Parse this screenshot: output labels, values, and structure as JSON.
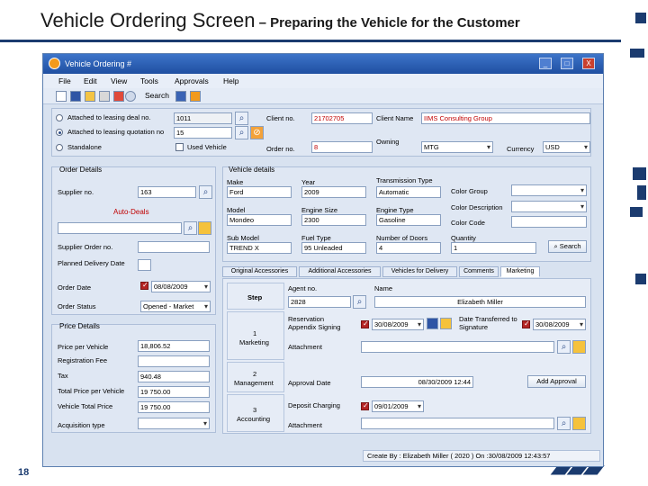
{
  "slide": {
    "title_main": "Vehicle Ordering Screen",
    "title_sub": " – Preparing the Vehicle for the Customer",
    "page_number": "18",
    "brand_color": "#1b3b6f"
  },
  "window": {
    "title": "Vehicle Ordering #",
    "title_color": "#1f4fa1",
    "minimize_label": "_",
    "maximize_label": "□",
    "close_label": "X"
  },
  "menu": {
    "items": [
      "File",
      "Edit",
      "View",
      "Tools",
      "Approvals",
      "Help"
    ]
  },
  "toolbar": {
    "search_label": "Search"
  },
  "order_source": {
    "option1": "Attached to leasing deal no.",
    "option2": "Attached to leasing quotation no",
    "option3": "Standalone",
    "deal_no": "1011",
    "quotation_no": "15",
    "used_vehicle_label": "Used Vehicle",
    "client_no_label": "Client no.",
    "client_no": "21702705",
    "client_name_label": "Client Name",
    "client_name": "IIMS Consulting Group",
    "order_no_label": "Order no.",
    "order_no": "8",
    "owning_label": "Owning",
    "owning_value": "MTG",
    "currency_label": "Currency",
    "currency_value": "USD"
  },
  "order_details": {
    "title": "Order Details",
    "supplier_no_label": "Supplier no.",
    "supplier_no": "163",
    "supplier_name": "Auto-Deals",
    "supplier_order_label": "Supplier Order no.",
    "planned_delivery_label": "Planned Delivery Date",
    "order_date_label": "Order Date",
    "order_date": "08/08/2009",
    "order_status_label": "Order Status",
    "order_status": "Opened - Market"
  },
  "price_details": {
    "title": "Price Details",
    "price_per_vehicle_label": "Price per Vehicle",
    "price_per_vehicle": "18,806.52",
    "registration_fee_label": "Registration Fee",
    "tax_label": "Tax",
    "tax": "940.48",
    "total_price_label": "Total Price per Vehicle",
    "total_price": "19 750.00",
    "vehicle_total_label": "Vehicle Total Price",
    "vehicle_total": "19 750.00",
    "acquisition_label": "Acquisition type"
  },
  "vehicle_details": {
    "title": "Vehicle details",
    "make_label": "Make",
    "make": "Ford",
    "year_label": "Year",
    "year": "2009",
    "transmission_label": "Transmission Type",
    "transmission": "Automatic",
    "color_group_label": "Color Group",
    "color_desc_label": "Color Description",
    "color_code_label": "Color Code",
    "model_label": "Model",
    "model": "Mondeo",
    "engine_size_label": "Engine Size",
    "engine_size": "2300",
    "engine_type_label": "Engine Type",
    "engine_type": "Gasoline",
    "sub_model_label": "Sub Model",
    "sub_model": "TREND X",
    "fuel_type_label": "Fuel Type",
    "fuel_type": "95 Unleaded",
    "doors_label": "Number of Doors",
    "doors": "4",
    "quantity_label": "Quantity",
    "quantity": "1",
    "search_label": "Search"
  },
  "tabs": [
    "Original Accessories",
    "Additional Accessories",
    "Vehicles for Delivery",
    "Comments",
    "Marketing"
  ],
  "marketing": {
    "step_header": "Step",
    "agent_header": "Agent no.",
    "name_header": "Name",
    "agent_no": "2828",
    "agent_name": "Elizabeth Miller",
    "step1_num": "1",
    "step1_name": "Marketing",
    "reservation_label": "Reservation Appendix Signing",
    "reservation_date": "30/08/2009",
    "transferred_label": "Date Transferred to Signature",
    "transferred_date": "30/08/2009",
    "attachment_label": "Attachment",
    "step2_num": "2",
    "step2_name": "Management",
    "approval_date_label": "Approval Date",
    "approval_date": "08/30/2009 12:44",
    "add_approval_label": "Add Approval",
    "step3_num": "3",
    "step3_name": "Accounting",
    "deposit_label": "Deposit Charging",
    "deposit_date": "09/01/2009",
    "attachment3_label": "Attachment"
  },
  "status_bar": {
    "text": "Create By : Elizabeth Miller ( 2020 ) On :30/08/2009 12:43:57"
  }
}
